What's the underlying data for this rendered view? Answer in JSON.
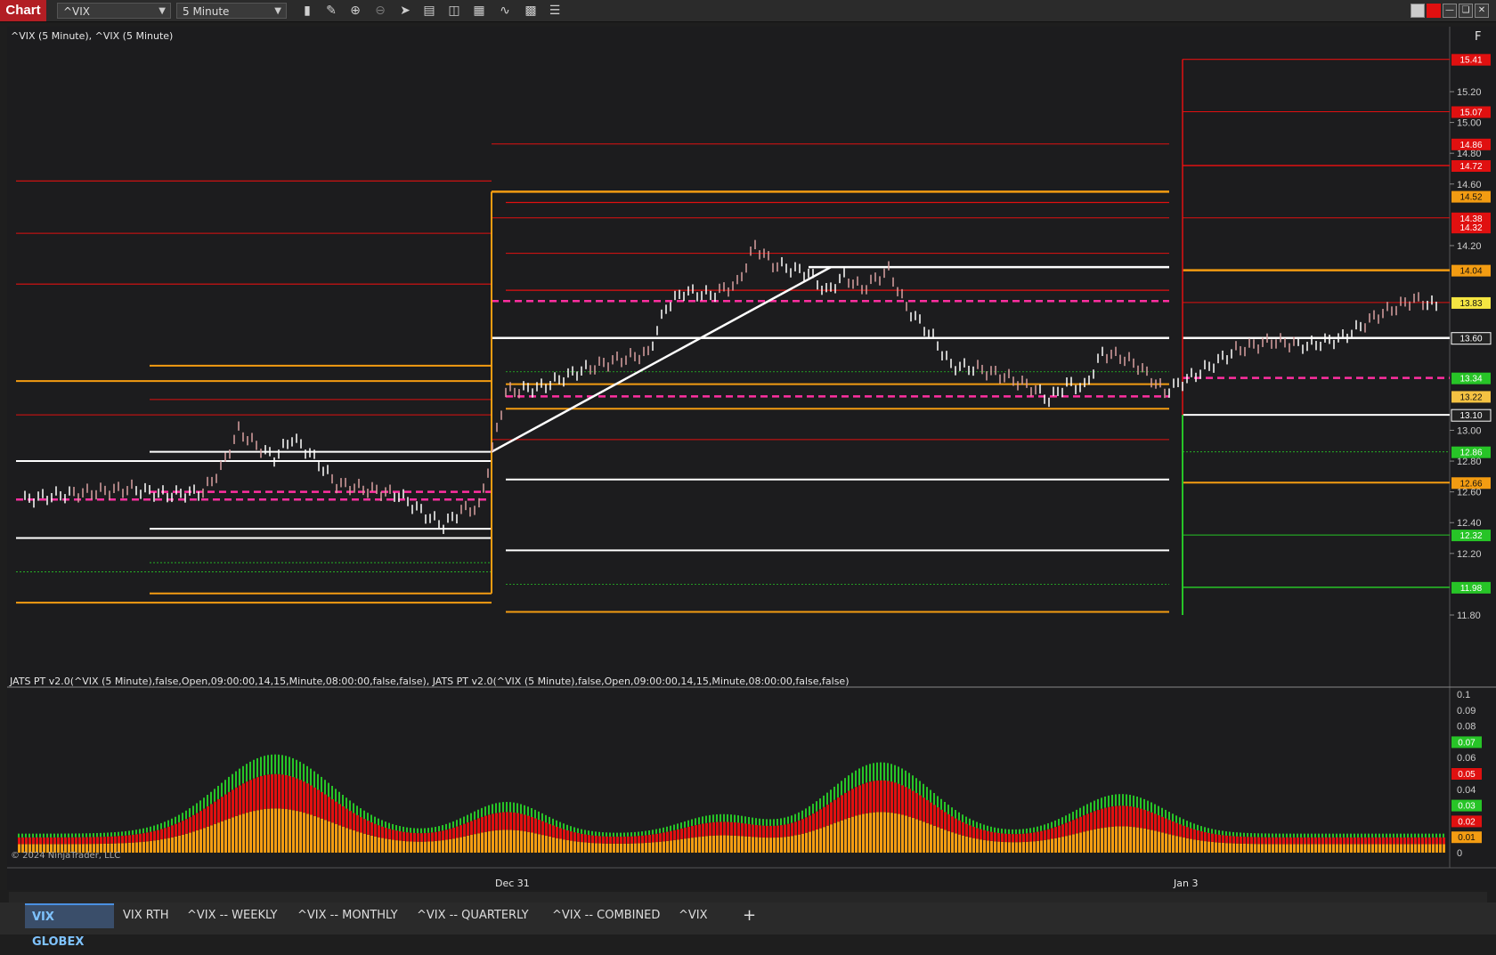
{
  "toolbar": {
    "chart_tab": "Chart",
    "instrument": "^VIX",
    "interval": "5 Minute",
    "tools": [
      "bar-chart-icon",
      "pencil-icon",
      "zoom-in-icon",
      "zoom-out-icon",
      "pointer-icon",
      "properties-icon",
      "template-icon",
      "strategy-icon",
      "indicator-icon",
      "calculator-icon",
      "list-icon"
    ]
  },
  "chart": {
    "title": "^VIX (5 Minute), ^VIX (5 Minute)",
    "indicator_label": "JATS PT v2.0(^VIX (5 Minute),false,Open,09:00:00,14,15,Minute,08:00:00,false,false), JATS PT v2.0(^VIX (5 Minute),false,Open,09:00:00,14,15,Minute,08:00:00,false,false)",
    "copyright": "© 2024 NinjaTrader, LLC",
    "corner_button": "F",
    "x_labels": [
      "Dec 31",
      "Jan 3"
    ]
  },
  "price_axis": {
    "ticks": [
      "15.20",
      "15.00",
      "14.80",
      "14.60",
      "14.20",
      "13.00",
      "12.80",
      "12.60",
      "12.40",
      "12.20",
      "11.80"
    ],
    "partial_ticks": [
      "14.80",
      "14.40",
      "13.80",
      "13.40",
      "13.14"
    ],
    "price_boxes": [
      {
        "text": "15.41",
        "color": "#e01010"
      },
      {
        "text": "15.07",
        "color": "#e01010"
      },
      {
        "text": "14.86",
        "color": "#e01010"
      },
      {
        "text": "14.72",
        "color": "#e01010"
      },
      {
        "text": "14.52",
        "color": "#f39c12"
      },
      {
        "text": "14.38",
        "color": "#e01010"
      },
      {
        "text": "14.32",
        "color": "#e01010"
      },
      {
        "text": "14.04",
        "color": "#f39c12"
      },
      {
        "text": "13.83",
        "color": "#f5e642"
      },
      {
        "text": "13.60",
        "color": "#222222"
      },
      {
        "text": "13.34",
        "color": "#27c427"
      },
      {
        "text": "13.22",
        "color": "#f5c242"
      },
      {
        "text": "13.10",
        "color": "#222222"
      },
      {
        "text": "12.86",
        "color": "#27c427"
      },
      {
        "text": "12.66",
        "color": "#f39c12"
      },
      {
        "text": "12.32",
        "color": "#27c427"
      },
      {
        "text": "11.98",
        "color": "#27c427"
      }
    ]
  },
  "indicator_axis": {
    "ticks": [
      "0.1",
      "0.09",
      "0.08",
      "0.06",
      "0.04",
      "0"
    ],
    "boxes": [
      {
        "text": "0.07",
        "color": "#27c427"
      },
      {
        "text": "0.05",
        "color": "#e01010"
      },
      {
        "text": "0.03",
        "color": "#27c427"
      },
      {
        "text": "0.02",
        "color": "#e01010"
      },
      {
        "text": "0.01",
        "color": "#f39c12"
      }
    ]
  },
  "tabs": [
    "VIX GLOBEX",
    "VIX RTH",
    "^VIX -- WEEKLY",
    "^VIX -- MONTHLY",
    "^VIX -- QUARTERLY",
    "^VIX -- COMBINED",
    "^VIX"
  ],
  "add_tab": "+"
}
